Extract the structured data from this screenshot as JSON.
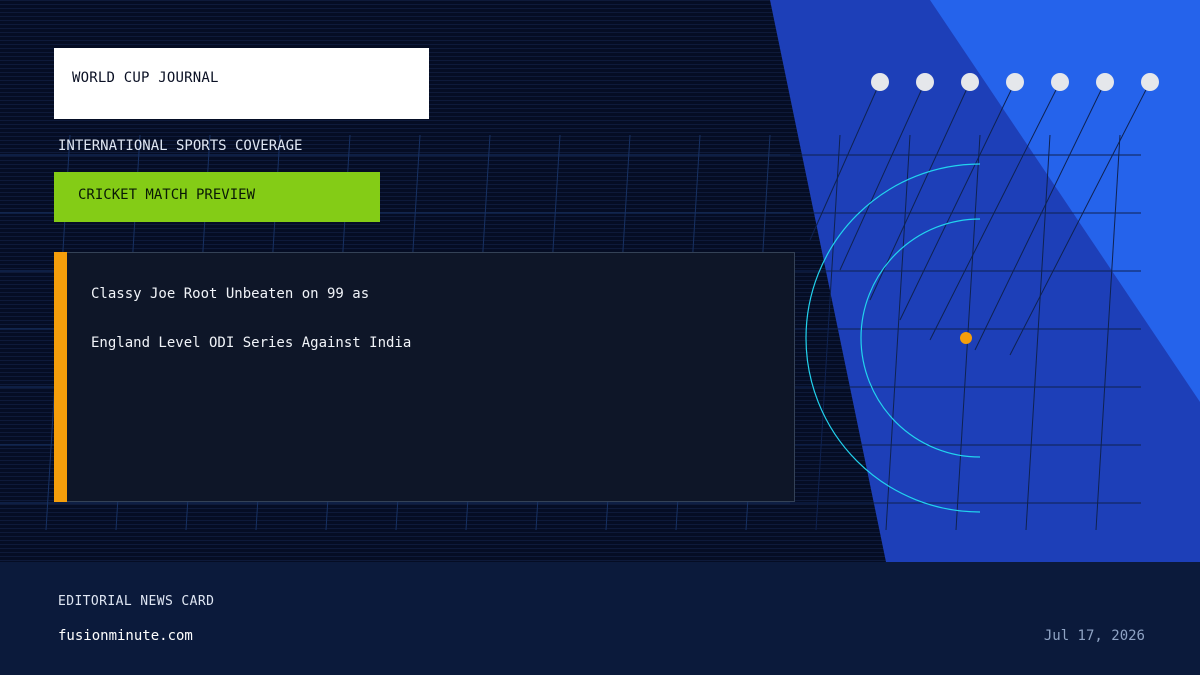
{
  "brand": {
    "name": "WORLD CUP JOURNAL"
  },
  "kicker": "INTERNATIONAL SPORTS COVERAGE",
  "tag": "CRICKET MATCH PREVIEW",
  "headline": {
    "line1": "Classy Joe Root Unbeaten on 99 as",
    "line2": "England Level ODI Series Against India"
  },
  "footer": {
    "label": "EDITORIAL NEWS CARD",
    "site": "fusionminute.com",
    "date": "Jul 17, 2026"
  },
  "colors": {
    "background": "#050d24",
    "panel_blue_dark": "#1d3fb8",
    "panel_blue_light": "#2563eb",
    "tag_green": "#84cc16",
    "accent_orange": "#f59e0b",
    "arc_cyan": "#22d3ee",
    "footer_bg": "#0b1a3b"
  }
}
